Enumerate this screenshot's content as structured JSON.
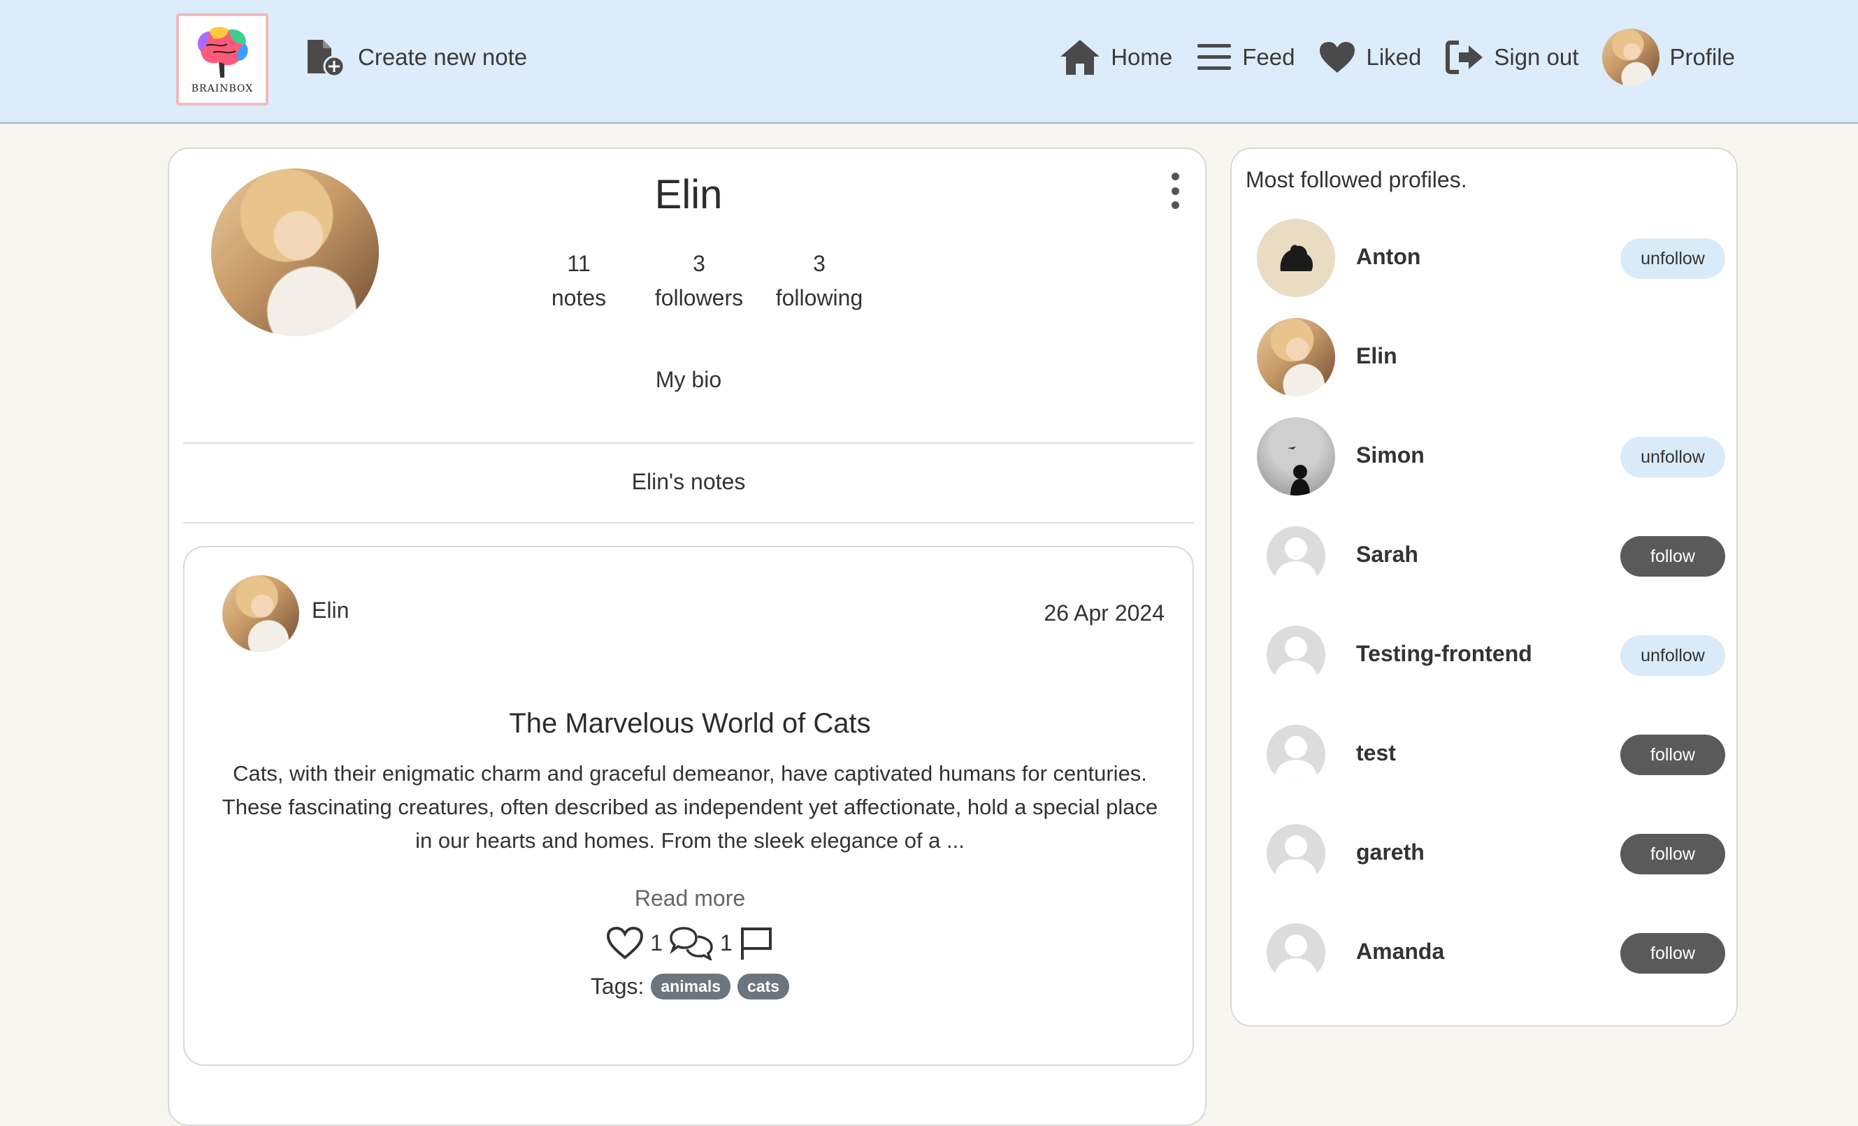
{
  "navbar": {
    "logo_text": "BRAINBOX",
    "create_label": "Create new note",
    "home_label": "Home",
    "feed_label": "Feed",
    "liked_label": "Liked",
    "signout_label": "Sign out",
    "profile_label": "Profile"
  },
  "profile": {
    "name": "Elin",
    "stats": [
      {
        "value": "11",
        "label": "notes"
      },
      {
        "value": "3",
        "label": "followers"
      },
      {
        "value": "3",
        "label": "following"
      }
    ],
    "bio": "My bio",
    "notes_heading": "Elin's notes"
  },
  "note": {
    "author": "Elin",
    "date": "26 Apr 2024",
    "title": "The Marvelous World of Cats",
    "body": "Cats, with their enigmatic charm and graceful demeanor, have captivated humans for centuries. These fascinating creatures, often described as independent yet affectionate, hold a special place in our hearts and homes. From the sleek elegance of a ...",
    "read_more": "Read more",
    "likes": "1",
    "comments": "1",
    "tags_label": "Tags:",
    "tags": [
      "animals",
      "cats"
    ]
  },
  "sidebar": {
    "title": "Most followed profiles.",
    "profiles": [
      {
        "name": "Anton",
        "button": "unfollow"
      },
      {
        "name": "Elin",
        "button": ""
      },
      {
        "name": "Simon",
        "button": "unfollow"
      },
      {
        "name": "Sarah",
        "button": "follow"
      },
      {
        "name": "Testing-frontend",
        "button": "unfollow"
      },
      {
        "name": "test",
        "button": "follow"
      },
      {
        "name": "gareth",
        "button": "follow"
      },
      {
        "name": "Amanda",
        "button": "follow"
      }
    ]
  },
  "colors": {
    "navbar_bg": "#dcecfa",
    "page_bg": "#f8f6f1",
    "follow_btn": "#5a5a5a",
    "unfollow_btn": "#d9eaf8",
    "tag_bg": "#6c757d"
  }
}
